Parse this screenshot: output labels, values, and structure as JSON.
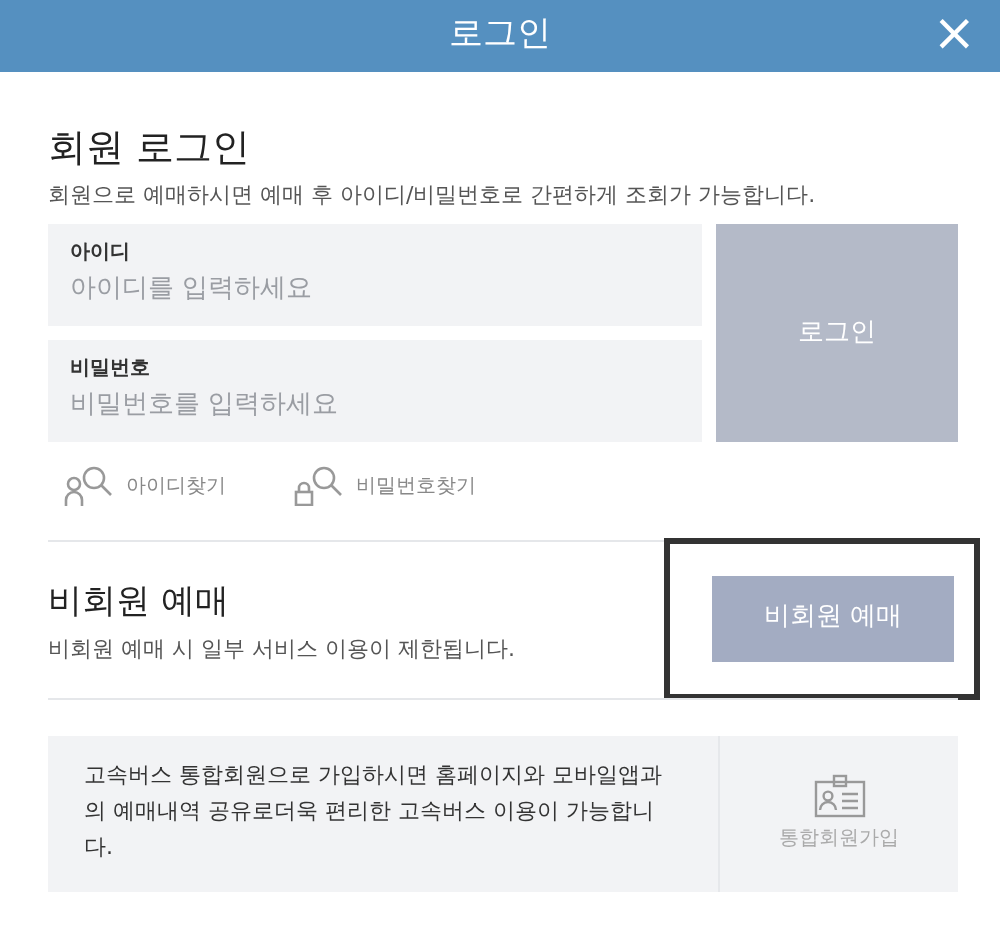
{
  "window": {
    "title": "로그인",
    "close": "×"
  },
  "member_login": {
    "title": "회원 로그인",
    "description": "회원으로 예매하시면 예매 후 아이디/비밀번호로 간편하게 조회가 가능합니다.",
    "fields": [
      {
        "label": "아이디",
        "placeholder": "아이디를 입력하세요"
      },
      {
        "label": "비밀번호",
        "placeholder": "비밀번호를 입력하세요"
      }
    ],
    "login_button": "로그인",
    "links": [
      {
        "label": "아이디찾기",
        "kind": "person"
      },
      {
        "label": "비밀번호찾기",
        "kind": "lock"
      }
    ]
  },
  "guest": {
    "title": "비회원 예매",
    "description": "비회원 예매 시 일부 서비스 이용이 제한됩니다.",
    "button": "비회원 예매",
    "highlighted": true
  },
  "signup": {
    "text": "고속버스 통합회원으로 가입하시면 홈페이지와 모바일앱과의 예매내역 공유로더욱 편리한 고속버스 이용이 가능합니다.",
    "button": "통합회원가입"
  }
}
